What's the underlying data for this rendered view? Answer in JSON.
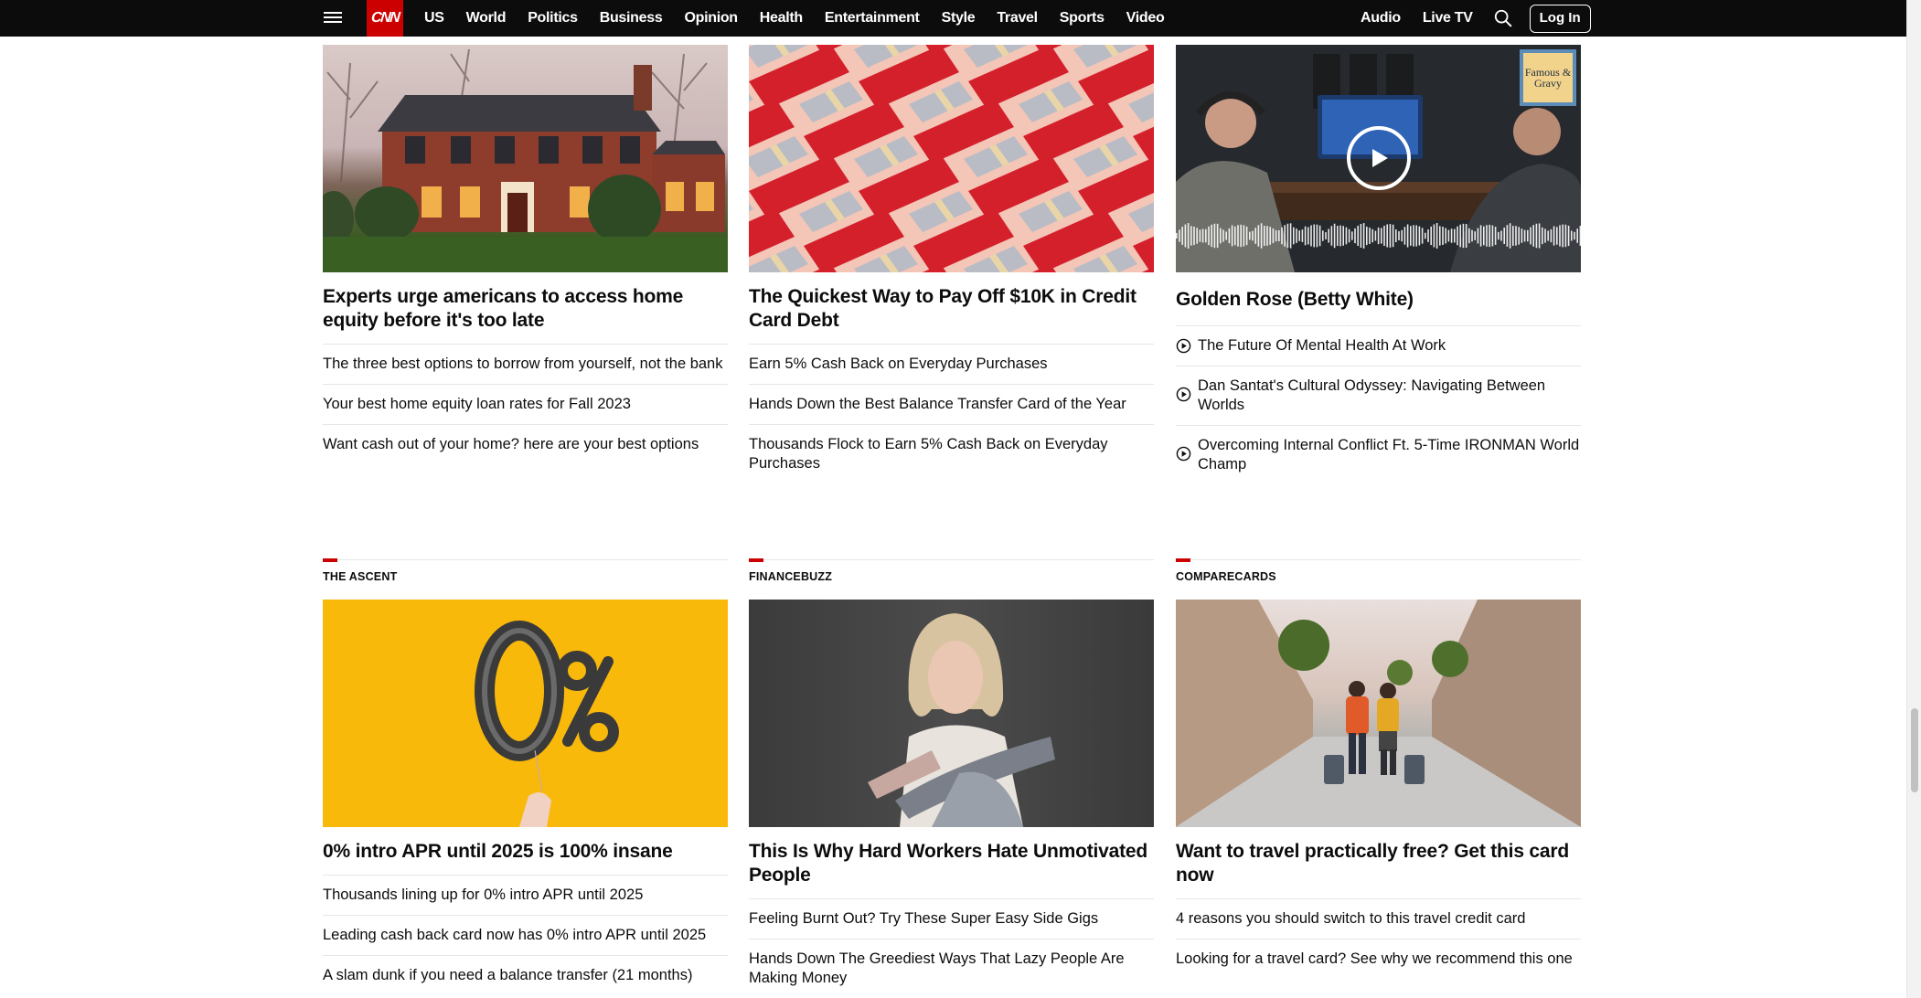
{
  "nav": {
    "logo": "CNN",
    "links": [
      "US",
      "World",
      "Politics",
      "Business",
      "Opinion",
      "Health",
      "Entertainment",
      "Style",
      "Travel",
      "Sports",
      "Video"
    ],
    "right_links": [
      "Audio",
      "Live TV"
    ],
    "login": "Log In"
  },
  "row1": [
    {
      "headline": "Experts urge americans to access home equity before it's too late",
      "image": "house-photo",
      "links": [
        "The three best options to borrow from yourself, not the bank",
        "Your best home equity loan rates for Fall 2023",
        "Want cash out of your home? here are your best options"
      ]
    },
    {
      "headline": "The Quickest Way to Pay Off $10K in Credit Card Debt",
      "image": "credit-cards-and-cash-photo",
      "links": [
        "Earn 5% Cash Back on Everyday Purchases",
        "Hands Down the Best Balance Transfer Card of the Year",
        "Thousands Flock to Earn 5% Cash Back on Everyday Purchases"
      ]
    },
    {
      "headline": "Golden Rose (Betty White)",
      "image": "podcast-studio-video",
      "badge": "Famous & Gravy",
      "links": [
        "The Future Of Mental Health At Work",
        "Dan Santat's Cultural Odyssey: Navigating Between Worlds",
        "Overcoming Internal Conflict Ft. 5-Time IRONMAN World Champ"
      ]
    }
  ],
  "row2": [
    {
      "label": "THE ASCENT",
      "headline": "0% intro APR until 2025 is 100% insane",
      "image": "zero-percent-balloon-photo",
      "links": [
        "Thousands lining up for 0% intro APR until 2025",
        "Leading cash back card now has 0% intro APR until 2025",
        "A slam dunk if you need a balance transfer (21 months)"
      ]
    },
    {
      "label": "FINANCEBUZZ",
      "headline": "This Is Why Hard Workers Hate Unmotivated People",
      "image": "woman-portrait-photo",
      "links": [
        "Feeling Burnt Out? Try These Super Easy Side Gigs",
        "Hands Down The Greediest Ways That Lazy People Are Making Money"
      ]
    },
    {
      "label": "COMPARECARDS",
      "headline": "Want to travel practically free? Get this card now",
      "image": "travelers-street-photo",
      "links": [
        "4 reasons you should switch to this travel credit card",
        "Looking for a travel card? See why we recommend this one"
      ]
    }
  ],
  "colors": {
    "brand_red": "#cc0000",
    "nav_bg": "#0c0c0c",
    "divider": "#e6e6e6"
  }
}
